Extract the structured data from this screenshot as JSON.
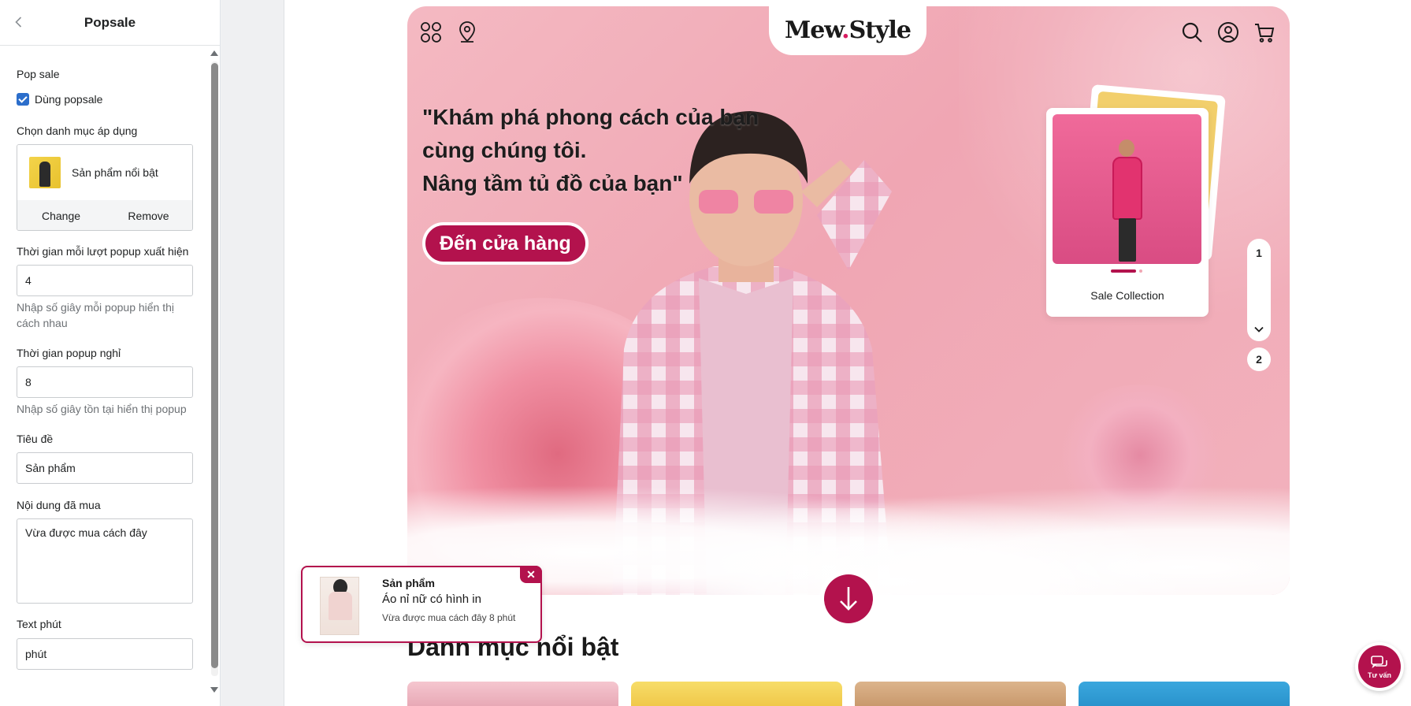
{
  "sidebar": {
    "title": "Popsale",
    "pop_sale_label": "Pop sale",
    "use_popsale_label": "Dùng popsale",
    "category_label": "Chọn danh mục áp dụng",
    "category_value": "Sản phẩm nổi bật",
    "change_label": "Change",
    "remove_label": "Remove",
    "interval_label": "Thời gian mỗi lượt popup xuất hiện",
    "interval_value": "4",
    "interval_help": "Nhập số giây mỗi popup hiển thị cách nhau",
    "rest_label": "Thời gian popup nghỉ",
    "rest_value": "8",
    "rest_help": "Nhập số giây tồn tại hiển thị popup",
    "heading_label": "Tiêu đề",
    "heading_value": "Sản phẩm",
    "purchased_label": "Nội dung đã mua",
    "purchased_value": "Vừa được mua cách đây",
    "minute_label": "Text phút",
    "minute_value": "phút"
  },
  "hero": {
    "logo_main": "Mew",
    "logo_dot": ".",
    "logo_end": "Style",
    "headline_1": "\"Khám phá phong cách của bạn",
    "headline_2": "cùng chúng tôi.",
    "headline_3": "Nâng tầm tủ đồ của bạn\"",
    "cta": "Đến cửa hàng",
    "card_title": "Sale Collection",
    "page_1": "1",
    "page_2": "2"
  },
  "section": {
    "title": "Danh mục nổi bật"
  },
  "popup": {
    "title": "Sản phẩm",
    "product": "Áo nỉ nữ có hình in",
    "meta": "Vừa được mua cách đây 8 phút",
    "close": "✕"
  },
  "chat": {
    "label": "Tư vấn"
  },
  "colors": {
    "accent": "#b3124d",
    "checkbox": "#2c6ecb",
    "hero_bg": "#f0a6b3"
  },
  "icons": [
    "chevron-left-icon",
    "grid-icon",
    "location-icon",
    "search-icon",
    "user-icon",
    "cart-icon",
    "chevron-down-icon",
    "arrow-down-icon",
    "close-icon",
    "chat-icon"
  ]
}
